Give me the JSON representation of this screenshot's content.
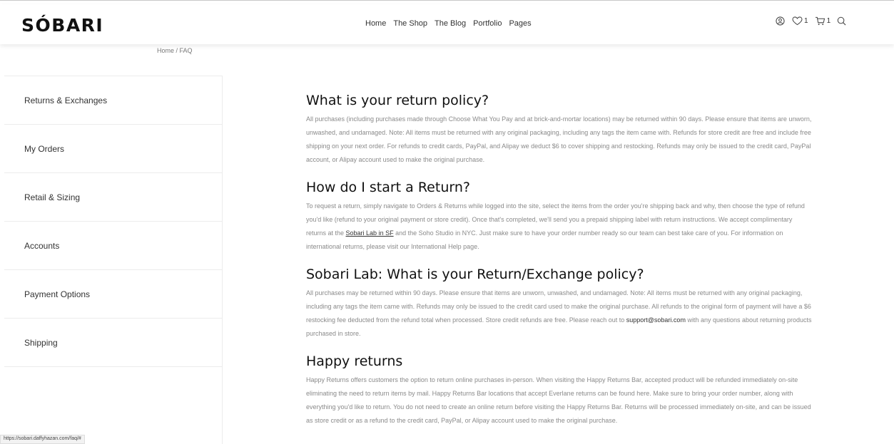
{
  "header": {
    "logo": "SÓBARI",
    "nav": [
      "Home",
      "The Shop",
      "The Blog",
      "Portfolio",
      "Pages"
    ],
    "wishlist_count": "1",
    "cart_count": "1",
    "icons": [
      "user-icon",
      "heart-icon",
      "cart-icon",
      "search-icon"
    ]
  },
  "breadcrumb": "Home / FAQ",
  "sidebar": {
    "items": [
      {
        "label": "Returns & Exchanges"
      },
      {
        "label": "My Orders"
      },
      {
        "label": "Retail & Sizing"
      },
      {
        "label": "Accounts"
      },
      {
        "label": "Payment Options"
      },
      {
        "label": "Shipping"
      }
    ]
  },
  "faq": [
    {
      "title": "What is your return policy?",
      "body": "All purchases (including purchases made through Choose What You Pay and at brick-and-mortar locations) may be returned within 90 days. Please ensure that items are unworn, unwashed, and undamaged. Note: All items must be returned with any original packaging, including any tags the item came with. Refunds for store credit are free and include free shipping on your next order. For refunds to credit cards, PayPal, and Alipay we deduct $6 to cover shipping and restocking. Refunds may only be issued to the credit card, PayPal account, or Alipay account used to make the original purchase."
    },
    {
      "title": "How do I start a Return?",
      "body_pre": "To request a return, simply navigate to Orders & Returns while logged into the site, select the items from the order you're shipping back and why, then choose the type of refund you'd like (refund to your original payment or store credit). Once that's completed, we'll send you a prepaid shipping label with return instructions. We accept complimentary returns at the ",
      "link": "Sobari Lab in SF",
      "body_post": " and the Soho Studio in NYC. Just make sure to have your order number ready so our team can best take care of you. For information on international returns, please visit our International Help page."
    },
    {
      "title": "Sobari Lab: What is your Return/Exchange policy?",
      "body_pre": "All purchases may be returned within 90 days. Please ensure that items are unworn, unwashed, and undamaged. Note: All items must be returned with any original packaging, including any tags the item came with. Refunds may only be issued to the credit card used to make the original purchase. All refunds to the original form of payment will have a $6 restocking fee deducted from the refund total when processed. Store credit refunds are free. Please reach out to ",
      "email": "support@sobari.com",
      "body_post": " with any questions about returning products purchased in store."
    },
    {
      "title": "Happy returns",
      "body": "Happy Returns offers customers the option to return online purchases in-person. When visiting the Happy Returns Bar, accepted product will be refunded immediately on-site eliminating the need to return items by mail. Happy Returns Bar locations that accept Everlane returns can be found here. Make sure to bring your order number, along with everything you'd like to return. You do not need to create an online return before visiting the Happy Returns Bar. Returns will be processed immediately on-site, and can be issued as store credit or as a refund to the credit card, PayPal, or Alipay account used to make the original purchase."
    }
  ],
  "status_url": "https://sobari.daffyhazan.com/faq/#"
}
